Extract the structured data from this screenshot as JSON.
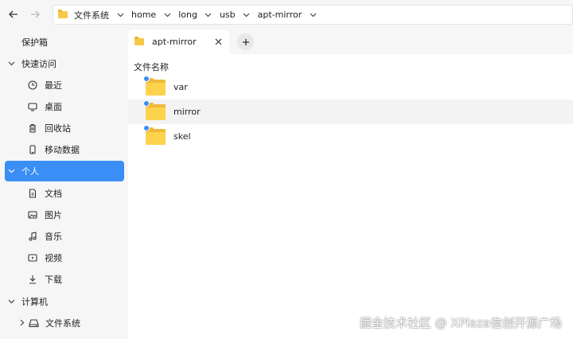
{
  "colors": {
    "accent": "#3a8ef6",
    "folder": "#fdd34e",
    "window_bg": "#f6f6f6",
    "content_bg": "#ffffff"
  },
  "toolbar": {
    "back_icon": "arrow-left-icon",
    "forward_icon": "arrow-right-icon"
  },
  "breadcrumb": [
    {
      "label": "文件系统",
      "icon": "folder-icon"
    },
    {
      "label": "home"
    },
    {
      "label": "long"
    },
    {
      "label": "usb"
    },
    {
      "label": "apt-mirror"
    }
  ],
  "sidebar": {
    "items": [
      {
        "label": "保护箱",
        "icon": "",
        "chevron": ""
      },
      {
        "label": "快速访问",
        "icon": "",
        "chevron": "chevron-down-icon"
      },
      {
        "label": "最近",
        "icon": "clock-icon",
        "chevron": ""
      },
      {
        "label": "桌面",
        "icon": "monitor-icon",
        "chevron": ""
      },
      {
        "label": "回收站",
        "icon": "trash-icon",
        "chevron": ""
      },
      {
        "label": "移动数据",
        "icon": "phone-icon",
        "chevron": ""
      },
      {
        "label": "个人",
        "icon": "",
        "chevron": "chevron-down-icon",
        "active": true
      },
      {
        "label": "文档",
        "icon": "document-icon",
        "chevron": ""
      },
      {
        "label": "图片",
        "icon": "image-icon",
        "chevron": ""
      },
      {
        "label": "音乐",
        "icon": "music-icon",
        "chevron": ""
      },
      {
        "label": "视频",
        "icon": "video-icon",
        "chevron": ""
      },
      {
        "label": "下载",
        "icon": "download-icon",
        "chevron": ""
      },
      {
        "label": "计算机",
        "icon": "",
        "chevron": "chevron-down-icon"
      },
      {
        "label": "文件系统",
        "icon": "drive-icon",
        "chevron": "chevron-right-icon"
      }
    ]
  },
  "tabs": [
    {
      "label": "apt-mirror",
      "icon": "folder-icon",
      "close_icon": "close-icon"
    }
  ],
  "new_tab_icon": "plus-icon",
  "file_list": {
    "column_header": "文件名称",
    "rows": [
      {
        "name": "var",
        "selected": false
      },
      {
        "name": "mirror",
        "selected": true
      },
      {
        "name": "skel",
        "selected": false
      }
    ]
  },
  "watermark": "掘金技术社区 @ XPlaza信创开源广场"
}
